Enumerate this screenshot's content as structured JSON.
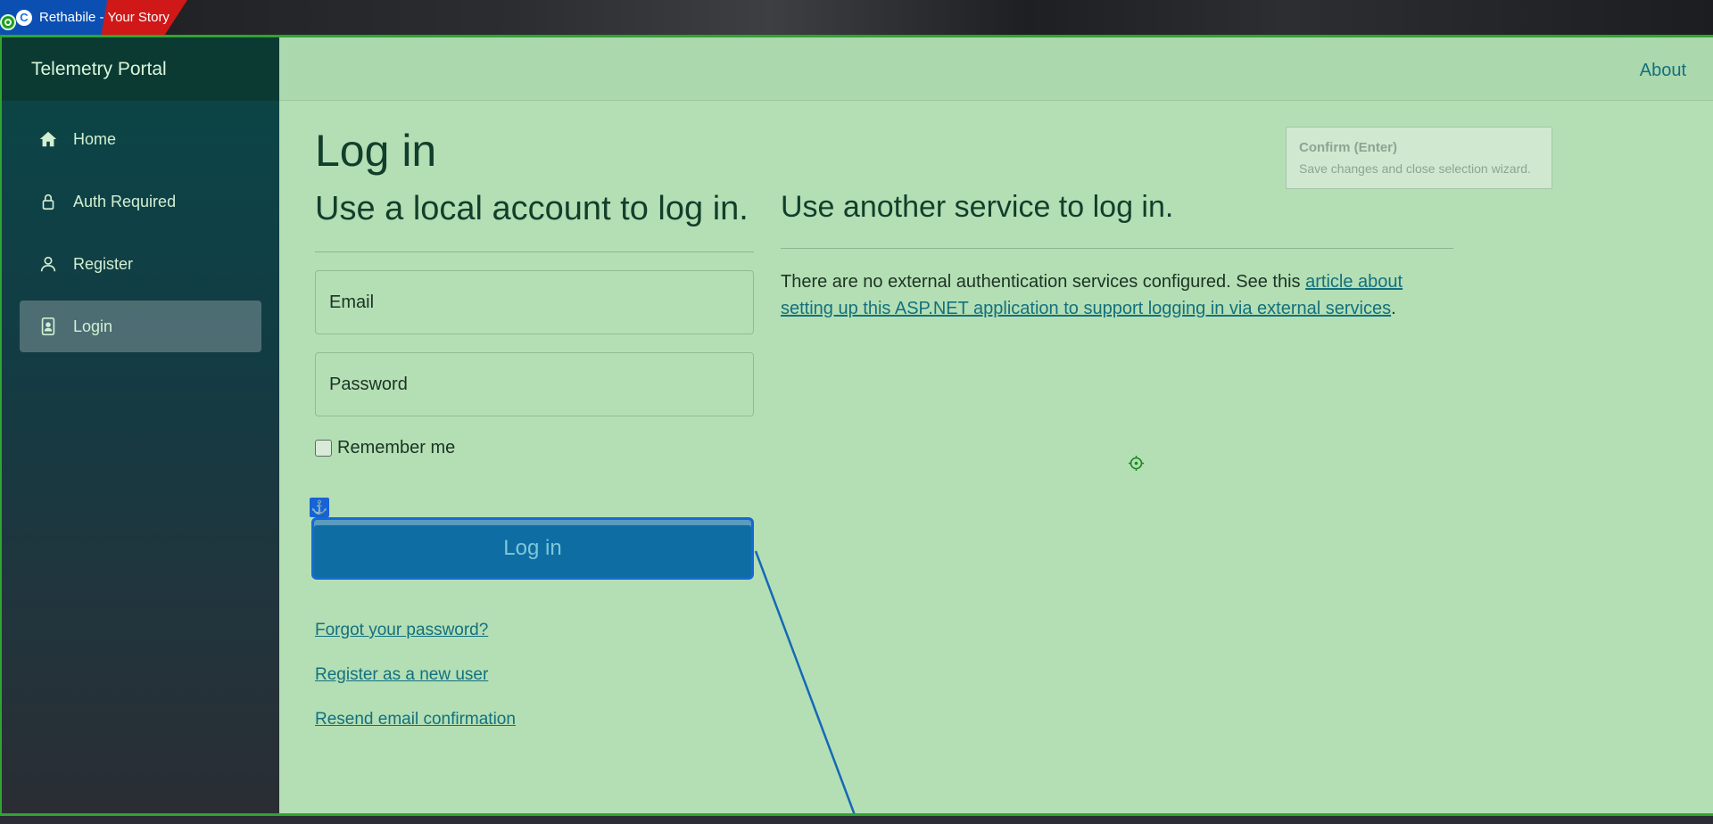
{
  "browser": {
    "tab_title_prefix": "Rethabile",
    "tab_title_suffix": " - Your Story"
  },
  "sidebar": {
    "brand": "Telemetry Portal",
    "items": [
      {
        "label": "Home",
        "icon": "home-icon",
        "active": false
      },
      {
        "label": "Auth Required",
        "icon": "lock-icon",
        "active": false
      },
      {
        "label": "Register",
        "icon": "person-icon",
        "active": false
      },
      {
        "label": "Login",
        "icon": "badge-icon",
        "active": true
      }
    ]
  },
  "header": {
    "about": "About"
  },
  "page": {
    "title": "Log in",
    "local_heading": "Use a local account to log in.",
    "email_placeholder": "Email",
    "password_placeholder": "Password",
    "remember_label": "Remember me",
    "login_button": "Log in",
    "links": [
      "Forgot your password?",
      "Register as a new user",
      "Resend email confirmation"
    ],
    "external_heading": "Use another service to log in.",
    "external_text": "There are no external authentication services configured. See this ",
    "external_link": "article about setting up this ASP.NET application to support logging in via external services",
    "external_tail": "."
  },
  "overlay": {
    "confirm_title": "Confirm (Enter)",
    "confirm_subtitle": "Save changes and close selection wizard."
  },
  "colors": {
    "page_bg": "#b4dfb5",
    "accent_link": "#13707e",
    "button": "#0e6ea3",
    "selection": "#1569d4"
  }
}
